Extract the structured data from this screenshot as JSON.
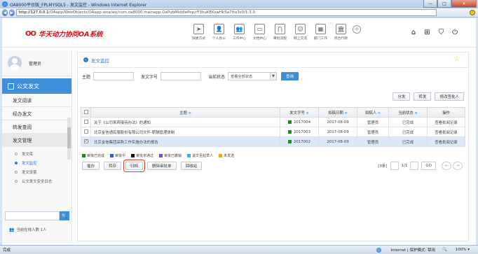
{
  "window": {
    "title": "OA8000平台版_FPLMYSQL5 - 发文监控 - Windows Internet Explorer",
    "minimize": "—",
    "maximize": "□",
    "close": "✕"
  },
  "address": {
    "url_host": "http://127.0.0.1",
    "url_path": "/OAapp/WebObjects/OAapp.woa/wo/com.oa8000.mainapp.OaPubMiddlePop/rF3huKEKswHk5a7tta3s0/1.3.0"
  },
  "app": {
    "logo_mark": "OO",
    "logo_name": "华天动力协同OA系统",
    "topnav": [
      {
        "label": "快捷方式",
        "icon": "paper-plane-icon",
        "glyph": "➤"
      },
      {
        "label": "个人办公",
        "icon": "person-icon",
        "glyph": "👤"
      },
      {
        "label": "工作中心",
        "icon": "people-icon",
        "glyph": "👥"
      },
      {
        "label": "文档中心",
        "icon": "document-icon",
        "glyph": "▭"
      },
      {
        "label": "审批流程",
        "icon": "flow-icon",
        "glyph": "⋂"
      },
      {
        "label": "网上交流",
        "icon": "chat-icon",
        "glyph": "☺"
      },
      {
        "label": "部门工作",
        "icon": "org-icon",
        "glyph": "▦"
      },
      {
        "label": "综合行政",
        "icon": "building-icon",
        "glyph": "🏛"
      }
    ],
    "rightnav": [
      {
        "icon": "home-icon",
        "glyph": "⌂"
      },
      {
        "icon": "grid-icon",
        "glyph": "⊞"
      },
      {
        "icon": "shirt-icon",
        "glyph": "⛉"
      },
      {
        "icon": "power-icon",
        "glyph": "⏻"
      }
    ]
  },
  "sidebar": {
    "username": "管理员",
    "section": "公文发文",
    "items": [
      "发文阅读",
      "经办发文",
      "转发查阅",
      "发文管理"
    ],
    "subitems": [
      "发文库",
      "发文监控",
      "发文设置",
      "公文发文安全日志"
    ],
    "active_sub": 1,
    "search_icon": "search-icon",
    "search_glyph": "🔍",
    "online_text": "当前在线人数 1人"
  },
  "main": {
    "breadcrumb": "发文监控",
    "filter": {
      "title_label": "主题",
      "doc_no_label": "发文字号",
      "status_label": "当前状态",
      "status_value": "查看全部状态",
      "query_button": "查询"
    },
    "top_actions": [
      "分发",
      "转发",
      "修改签批人"
    ],
    "columns": [
      "主题",
      "发文字号",
      "拟稿日期",
      "拟稿人",
      "当前状态",
      "操作"
    ],
    "rows": [
      {
        "title": "关于《公司来宾接待办法》的通知",
        "doc_no": "2017004",
        "date": "2017-08-09",
        "author": "管理员",
        "status": "已完成",
        "action": "查看批阅记录",
        "checked": false
      },
      {
        "title": "北京金信通民服股份有限公司文件-薪酬管理体制",
        "doc_no": "2017003",
        "date": "2017-08-09",
        "author": "管理员",
        "status": "已完成",
        "action": "查看批阅记录",
        "checked": false
      },
      {
        "title": "北京金信集团采购工作实施办法的报告",
        "doc_no": "2017002",
        "date": "2017-08-09",
        "author": "管理员",
        "status": "已完成",
        "action": "查看批阅记录",
        "checked": true
      }
    ],
    "legend": [
      {
        "label": "审批已完成",
        "color": "#1a8a1a"
      },
      {
        "label": "审批中",
        "color": "#2b5fd0"
      },
      {
        "label": "审批未通过",
        "color": "#111111"
      },
      {
        "label": "审批已撤销",
        "color": "#8a3fd0"
      },
      {
        "label": "退文至起草人",
        "color": "#3bb0e0"
      },
      {
        "label": "未发送",
        "color": "#f0a020"
      }
    ],
    "bottom_buttons": [
      "催办",
      "转存",
      "归档",
      "删除审批单",
      "回收站"
    ],
    "highlight_button": 2,
    "pager": {
      "count": "[3条]",
      "page": "1/1",
      "go": "GO",
      "prev": "←",
      "next": "→"
    }
  },
  "statusbar": {
    "left": "完成",
    "zone": "Internet | 保护模式: 禁用",
    "zoom": "100%"
  }
}
